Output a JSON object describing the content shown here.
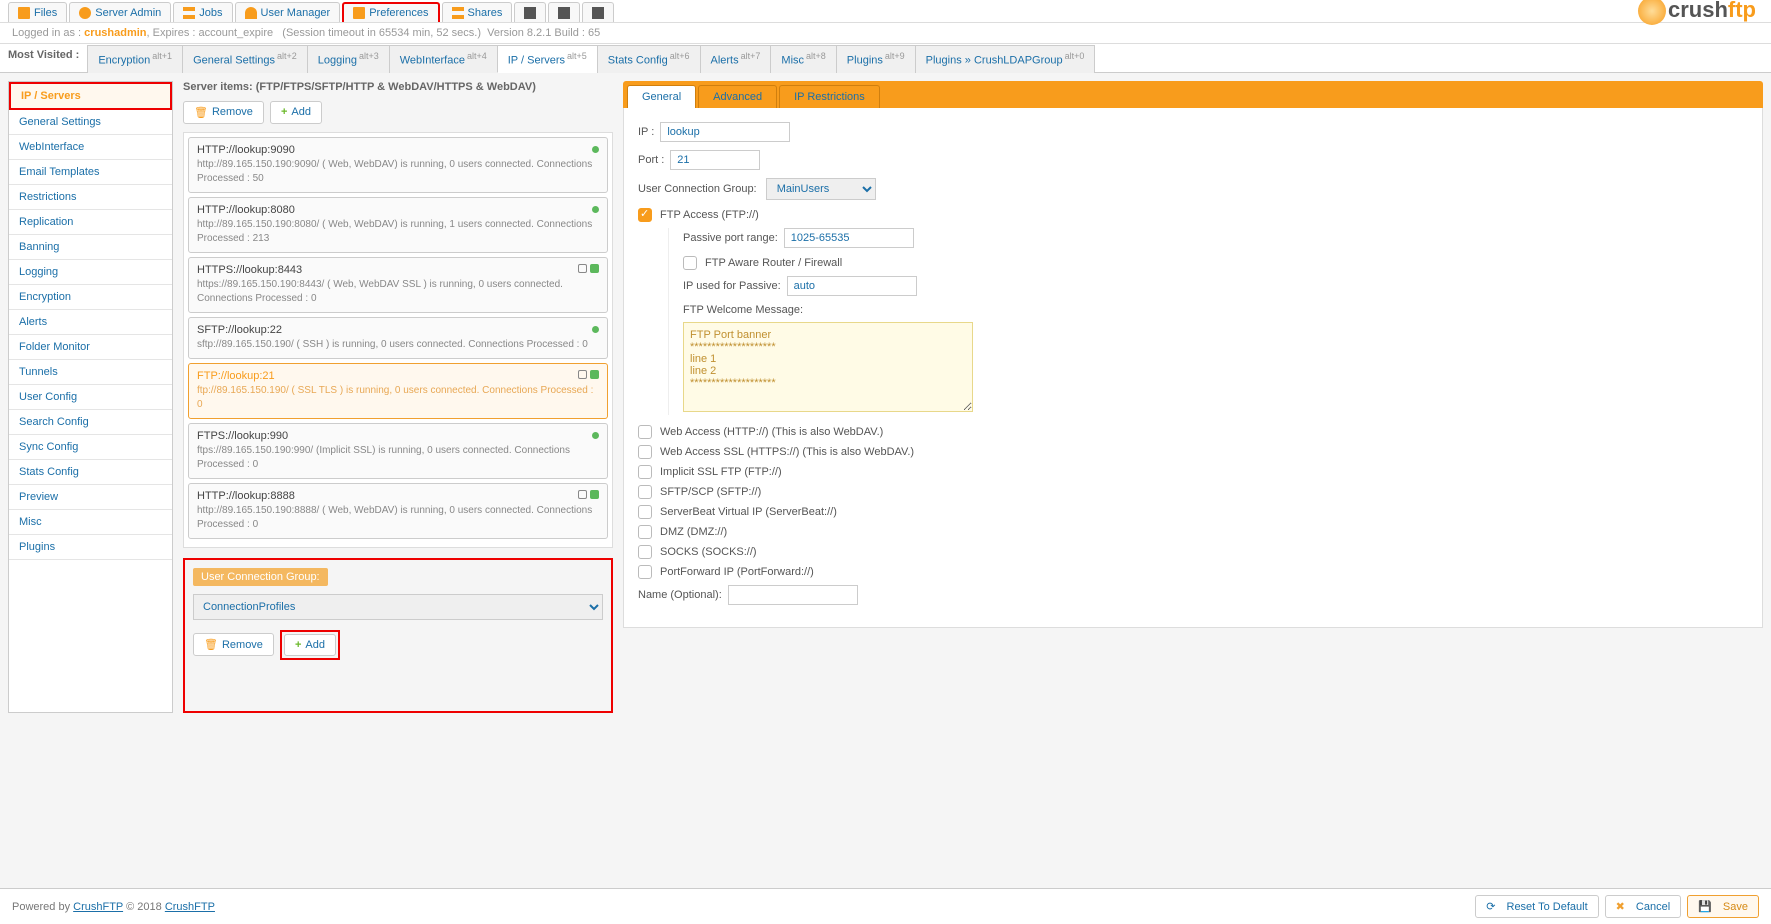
{
  "top_tabs": [
    "Files",
    "Server Admin",
    "Jobs",
    "User Manager",
    "Preferences",
    "Shares"
  ],
  "top_tab_hl_index": 4,
  "logo": {
    "brand1": "crush",
    "brand2": "ftp"
  },
  "status": {
    "prefix": "Logged in as : ",
    "user": "crushadmin",
    "expires": ", Expires : account_expire",
    "timeout": "(Session timeout in 65534 min, 52 secs.)",
    "version": "Version 8.2.1 Build : 65"
  },
  "most_visited_label": "Most Visited :",
  "sub_tabs": [
    {
      "label": "Encryption",
      "alt": "alt+1"
    },
    {
      "label": "General Settings",
      "alt": "alt+2"
    },
    {
      "label": "Logging",
      "alt": "alt+3"
    },
    {
      "label": "WebInterface",
      "alt": "alt+4"
    },
    {
      "label": "IP / Servers",
      "alt": "alt+5",
      "active": true
    },
    {
      "label": "Stats Config",
      "alt": "alt+6"
    },
    {
      "label": "Alerts",
      "alt": "alt+7"
    },
    {
      "label": "Misc",
      "alt": "alt+8"
    },
    {
      "label": "Plugins",
      "alt": "alt+9"
    },
    {
      "label": "Plugins » CrushLDAPGroup",
      "alt": "alt+0"
    }
  ],
  "sidebar": [
    {
      "label": "IP / Servers",
      "active": true,
      "hl": true
    },
    {
      "label": "General Settings"
    },
    {
      "label": "WebInterface"
    },
    {
      "label": "Email Templates"
    },
    {
      "label": "Restrictions"
    },
    {
      "label": "Replication"
    },
    {
      "label": "Banning"
    },
    {
      "label": "Logging"
    },
    {
      "label": "Encryption"
    },
    {
      "label": "Alerts"
    },
    {
      "label": "Folder Monitor"
    },
    {
      "label": "Tunnels"
    },
    {
      "label": "User Config"
    },
    {
      "label": "Search Config"
    },
    {
      "label": "Sync Config"
    },
    {
      "label": "Stats Config"
    },
    {
      "label": "Preview"
    },
    {
      "label": "Misc"
    },
    {
      "label": "Plugins"
    }
  ],
  "server_items_title": "Server items: (FTP/FTPS/SFTP/HTTP & WebDAV/HTTPS & WebDAV)",
  "btn_remove": "Remove",
  "btn_add": "Add",
  "servers": [
    {
      "hdr": "HTTP://lookup:9090",
      "sub": "http://89.165.150.190:9090/ ( Web, WebDAV) is running, 0 users connected. Connections Processed : 50",
      "dot": true
    },
    {
      "hdr": "HTTP://lookup:8080",
      "sub": "http://89.165.150.190:8080/ ( Web, WebDAV) is running, 1 users connected. Connections Processed : 213",
      "dot": true
    },
    {
      "hdr": "HTTPS://lookup:8443",
      "sub": "https://89.165.150.190:8443/ ( Web, WebDAV SSL ) is running, 0 users connected. Connections Processed : 0",
      "icons": true
    },
    {
      "hdr": "SFTP://lookup:22",
      "sub": "sftp://89.165.150.190/ ( SSH ) is running, 0 users connected. Connections Processed : 0",
      "dot": true
    },
    {
      "hdr": "FTP://lookup:21",
      "sub": "ftp://89.165.150.190/ ( SSL TLS ) is running, 0 users connected. Connections Processed : 0",
      "icons": true,
      "sel": true
    },
    {
      "hdr": "FTPS://lookup:990",
      "sub": "ftps://89.165.150.190:990/ (Implicit SSL) is running, 0 users connected. Connections Processed : 0",
      "dot": true
    },
    {
      "hdr": "HTTP://lookup:8888",
      "sub": "http://89.165.150.190:8888/ ( Web, WebDAV) is running, 0 users connected. Connections Processed : 0",
      "icons": true
    }
  ],
  "ucg": {
    "label": "User Connection Group:",
    "value": "ConnectionProfiles"
  },
  "panel_tabs": [
    "General",
    "Advanced",
    "IP Restrictions"
  ],
  "panel_tab_active": 0,
  "form": {
    "ip_label": "IP :",
    "ip": "lookup",
    "port_label": "Port :",
    "port": "21",
    "ucg_label": "User Connection Group:",
    "ucg": "MainUsers",
    "passive_label": "Passive port range:",
    "passive": "1025-65535",
    "aware": "FTP Aware Router / Firewall",
    "ip_passive_label": "IP used for Passive:",
    "ip_passive": "auto",
    "welcome_label": "FTP Welcome Message:",
    "welcome_text": "FTP Port banner\n********************\nline 1\nline 2\n********************",
    "name_label": "Name (Optional):",
    "name": ""
  },
  "access_options": [
    {
      "label": "FTP Access (FTP://)",
      "on": true,
      "sub": true
    },
    {
      "label": "Web Access (HTTP://) (This is also WebDAV.)"
    },
    {
      "label": "Web Access SSL (HTTPS://) (This is also WebDAV.)"
    },
    {
      "label": "Implicit SSL FTP (FTP://)"
    },
    {
      "label": "SFTP/SCP (SFTP://)"
    },
    {
      "label": "ServerBeat Virtual IP (ServerBeat://)"
    },
    {
      "label": "DMZ (DMZ://)"
    },
    {
      "label": "SOCKS (SOCKS://)"
    },
    {
      "label": "PortForward IP (PortForward://)"
    }
  ],
  "footer": {
    "powered": "Powered by ",
    "link": "CrushFTP",
    "mid": " © 2018 ",
    "link2": "CrushFTP",
    "reset": "Reset To Default",
    "cancel": "Cancel",
    "save": "Save"
  }
}
